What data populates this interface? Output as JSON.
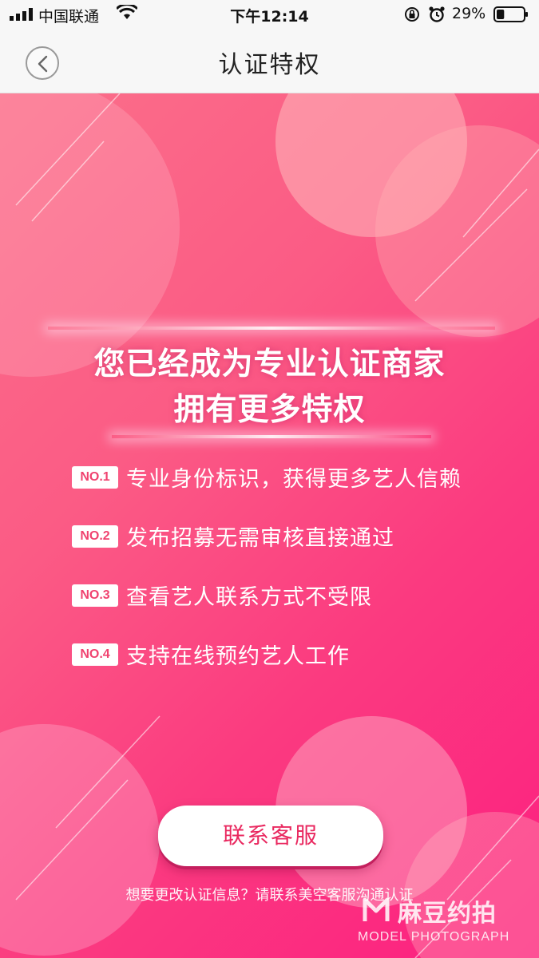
{
  "status_bar": {
    "carrier": "中国联通",
    "time": "下午12:14",
    "battery_percent": "29%",
    "battery_level": 0.29,
    "icons": [
      "signal-icon",
      "wifi-icon",
      "orientation-lock-icon",
      "alarm-icon",
      "battery-icon"
    ]
  },
  "nav": {
    "title": "认证特权",
    "back_icon": "chevron-left-icon"
  },
  "main": {
    "headline_line1": "您已经成为专业认证商家",
    "headline_line2": "拥有更多特权",
    "benefits": [
      {
        "badge": "NO.1",
        "text": "专业身份标识，获得更多艺人信赖"
      },
      {
        "badge": "NO.2",
        "text": "发布招募无需审核直接通过"
      },
      {
        "badge": "NO.3",
        "text": "查看艺人联系方式不受限"
      },
      {
        "badge": "NO.4",
        "text": "支持在线预约艺人工作"
      }
    ],
    "contact_button_label": "联系客服",
    "footer_note": "想要更改认证信息？请联系美空客服沟通认证"
  },
  "watermark": {
    "brand_cn": "麻豆约拍",
    "brand_en": "MODEL PHOTOGRAPH"
  },
  "colors": {
    "gradient_start": "#fb6f8a",
    "gradient_end": "#fc1f80",
    "badge_text": "#f0426f",
    "button_text": "#e9285f"
  }
}
